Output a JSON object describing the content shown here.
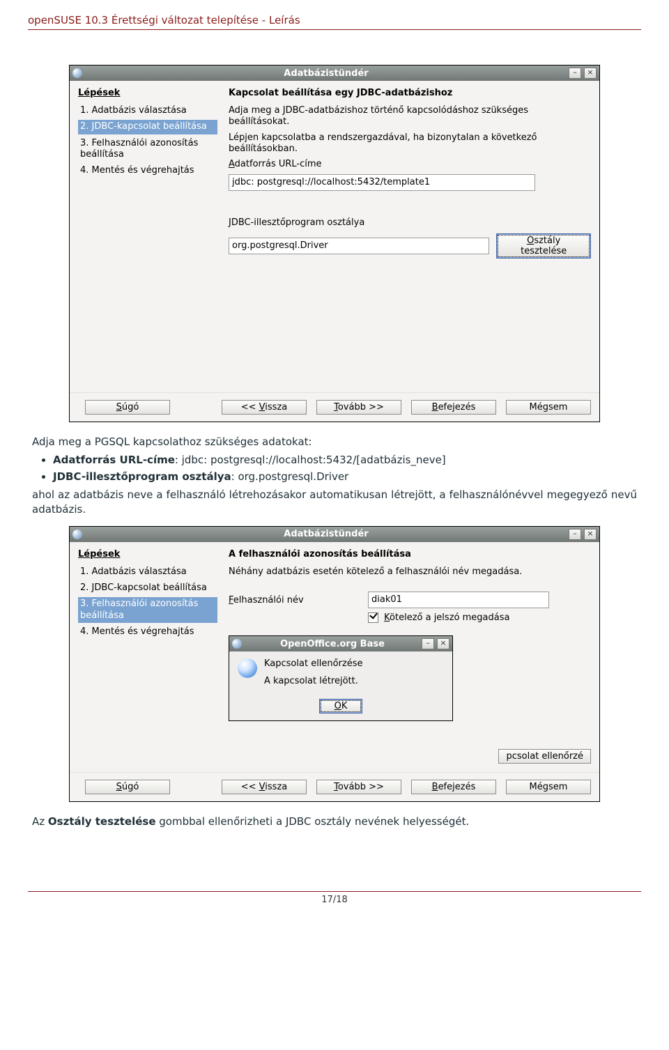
{
  "doc": {
    "header": "openSUSE 10.3 Érettségi változat telepítése - Leírás",
    "page_num": "17/18"
  },
  "s1": {
    "title": "Adatbázistündér",
    "steps_heading": "Lépések",
    "steps": [
      "1. Adatbázis választása",
      "2. JDBC-kapcsolat beállítása",
      "3. Felhasználói azonosítás beállítása",
      "4. Mentés és végrehajtás"
    ],
    "selected_step": 1,
    "heading": "Kapcsolat beállítása egy JDBC-adatbázishoz",
    "para1": "Adja meg a JDBC-adatbázishoz történő kapcsolódáshoz szükséges beállításokat.",
    "para2": "Lépjen kapcsolatba a rendszergazdával, ha bizonytalan a következő beállításokban.",
    "url_label_pre": "A",
    "url_label_rest": "datforrás URL-címe",
    "url_value": "jdbc: postgresql://localhost:5432/template1",
    "driver_label": "JDBC-illesztőprogram osztálya",
    "driver_value": "org.postgresql.Driver",
    "test_pre": "O",
    "test_rest": "sztály tesztelése",
    "buttons": {
      "help_pre": "S",
      "help_rest": "úgó",
      "back_pre": "<< ",
      "back_u": "V",
      "back_rest": "issza",
      "next_u": "T",
      "next_rest": "ovább >>",
      "finish_u": "B",
      "finish_rest": "efejezés",
      "cancel": "Mégsem"
    }
  },
  "desc1": {
    "intro": "Adja meg a PGSQL kapcsolathoz szükséges adatokat:",
    "li1_label": "Adatforrás URL-címe",
    "li1_val": ": jdbc: postgresql://localhost:5432/[adatbázis_neve]",
    "li2_label": "JDBC-illesztőprogram osztálya",
    "li2_val": ": org.postgresql.Driver",
    "after": "ahol az adatbázis neve a felhasználó létrehozásakor automatikusan létrejött, a felhasználónévvel megegyező nevű adatbázis."
  },
  "s2": {
    "title": "Adatbázistündér",
    "steps_heading": "Lépések",
    "steps": [
      "1. Adatbázis választása",
      "2. JDBC-kapcsolat beállítása",
      "3. Felhasználói azonosítás beállítása",
      "4. Mentés és végrehajtás"
    ],
    "selected_step": 2,
    "heading": "A felhasználói azonosítás beállítása",
    "para1": "Néhány adatbázis esetén kötelező a felhasználói név megadása.",
    "user_label_u": "F",
    "user_label_rest": "elhasználói név",
    "user_value": "diak01",
    "pw_pre": "K",
    "pw_rest": "ötelező a jelszó megadása",
    "inner": {
      "title": "OpenOffice.org Base",
      "line1": "Kapcsolat ellenőrzése",
      "line2": "A kapcsolat létrejött.",
      "ok_u": "O",
      "ok_rest": "K"
    },
    "chip": "pcsolat ellenőrzé",
    "buttons": {
      "help_pre": "S",
      "help_rest": "úgó",
      "back_pre": "<< ",
      "back_u": "V",
      "back_rest": "issza",
      "next_u": "T",
      "next_rest": "ovább >>",
      "finish_u": "B",
      "finish_rest": "efejezés",
      "cancel": "Mégsem"
    }
  },
  "desc2": "Az Osztály tesztelése gombbal ellenőrizheti a JDBC osztály nevének helyességét.",
  "desc2_strong": "Osztály tesztelése"
}
